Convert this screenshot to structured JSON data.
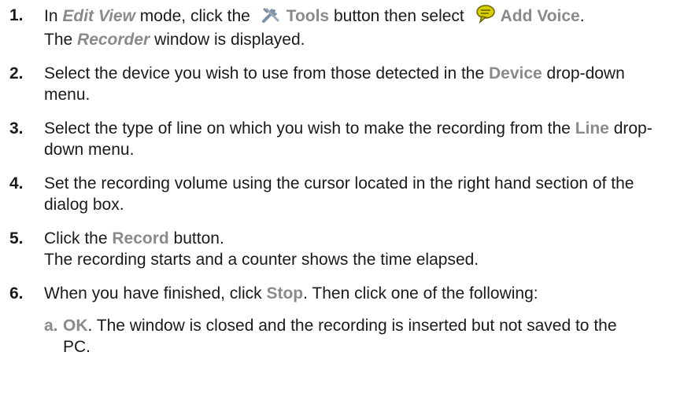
{
  "steps": [
    {
      "number": "1.",
      "p1": "In ",
      "edit_view": "Edit View",
      "p2": " mode, click the ",
      "tools_icon": "tools-icon",
      "tools": "Tools",
      "p3": " button then select ",
      "voice_icon": "voice-bubble-icon",
      "add_voice": "Add Voice",
      "p4": ".",
      "line2_pre": "The ",
      "recorder": "Recorder",
      "line2_post": " window is displayed."
    },
    {
      "number": "2.",
      "p1": "Select the device you wish to use from those detected in the ",
      "device": "Device",
      "p2": " drop-down menu."
    },
    {
      "number": "3.",
      "p1": "Select the type of line on which you wish to make the recording from the ",
      "line": "Line",
      "p2": " drop-down menu."
    },
    {
      "number": "4.",
      "text": "Set the recording volume using the cursor located in the right hand section of the dialog box."
    },
    {
      "number": "5.",
      "p1": "Click the ",
      "record": "Record",
      "p2": " button.",
      "line2": "The recording starts and a counter shows the time elapsed."
    },
    {
      "number": "6.",
      "p1": "When you have finished, click ",
      "stop": "Stop",
      "p2": ". Then click one of the following:"
    }
  ],
  "substeps": [
    {
      "letter": "a.",
      "ok": "OK",
      "text": ". The window is closed and the recording is inserted but not saved to the PC."
    }
  ],
  "colors": {
    "ui_gray": "#8a8a8a",
    "tools_icon": "#7d8fa3",
    "voice_icon": "#c9c200"
  }
}
